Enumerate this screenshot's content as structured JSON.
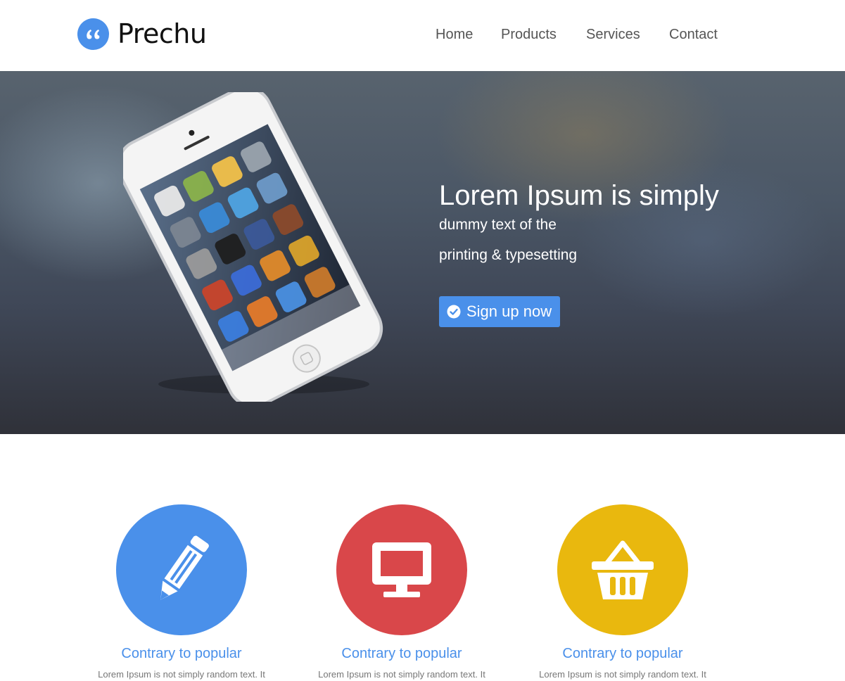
{
  "header": {
    "brand": "Prechu",
    "logo_icon": "quote-icon",
    "nav": [
      {
        "label": "Home"
      },
      {
        "label": "Products"
      },
      {
        "label": "Services"
      },
      {
        "label": "Contact"
      }
    ]
  },
  "hero": {
    "title": "Lorem Ipsum is simply",
    "subtitle_line1": "dummy text of the",
    "subtitle_line2": "printing & typesetting",
    "cta_label": "Sign up now",
    "cta_icon": "check-circle-icon",
    "image": "smartphone-image"
  },
  "features": [
    {
      "title": "Contrary to popular",
      "text": "Lorem Ipsum is not simply random text. It",
      "icon": "pencil-icon",
      "color": "#4a90ea"
    },
    {
      "title": "Contrary to popular",
      "text": "Lorem Ipsum is not simply random text. It",
      "icon": "monitor-icon",
      "color": "#d9474a"
    },
    {
      "title": "Contrary to popular",
      "text": "Lorem Ipsum is not simply random text. It",
      "icon": "basket-icon",
      "color": "#e9b80e"
    }
  ],
  "colors": {
    "accent": "#4a90ea",
    "red": "#d9474a",
    "yellow": "#e9b80e"
  }
}
